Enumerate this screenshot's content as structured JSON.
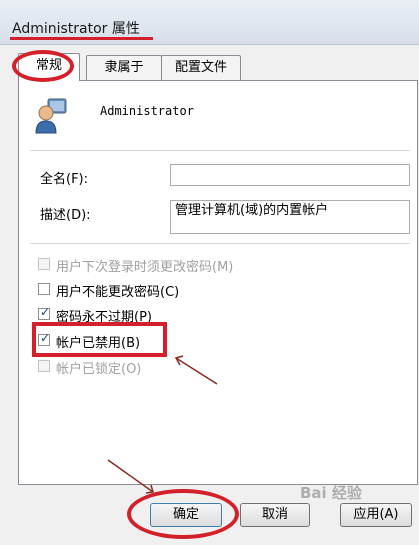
{
  "window": {
    "title": "Administrator 属性"
  },
  "tabs": [
    {
      "label": "常规",
      "active": true
    },
    {
      "label": "隶属于",
      "active": false
    },
    {
      "label": "配置文件",
      "active": false
    }
  ],
  "user": {
    "name": "Administrator",
    "icon": "user-icon"
  },
  "fields": {
    "fullname_label": "全名(F):",
    "fullname_value": "",
    "desc_label": "描述(D):",
    "desc_value": "管理计算机(域)的内置帐户"
  },
  "checkboxes": [
    {
      "label": "用户下次登录时须更改密码(M)",
      "checked": false,
      "enabled": false
    },
    {
      "label": "用户不能更改密码(C)",
      "checked": false,
      "enabled": true
    },
    {
      "label": "密码永不过期(P)",
      "checked": true,
      "enabled": true
    },
    {
      "label": "帐户已禁用(B)",
      "checked": true,
      "enabled": true
    },
    {
      "label": "帐户已锁定(O)",
      "checked": false,
      "enabled": false
    }
  ],
  "buttons": {
    "ok": "确定",
    "cancel": "取消",
    "apply": "应用(A)"
  },
  "annotations": {
    "highlight_color": "#d3202a"
  },
  "watermark": "Bai 经验"
}
